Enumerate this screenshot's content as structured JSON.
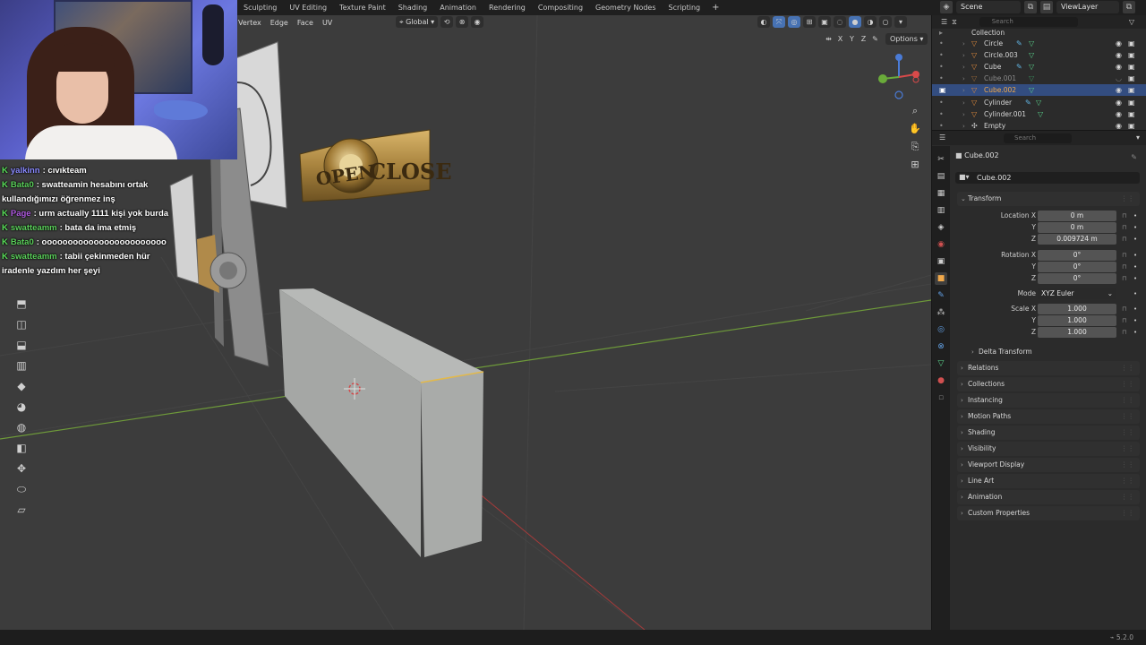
{
  "topbar": {
    "workspaces": [
      "Sculpting",
      "UV Editing",
      "Texture Paint",
      "Shading",
      "Animation",
      "Rendering",
      "Compositing",
      "Geometry Nodes",
      "Scripting"
    ],
    "add_tab": "+",
    "scene": "Scene",
    "view_layer": "ViewLayer"
  },
  "viewport_header": {
    "menus": [
      "Vertex",
      "Edge",
      "Face",
      "UV"
    ],
    "orientation": "Global",
    "options": "Options",
    "axis_x": "X",
    "axis_y": "Y",
    "axis_z": "Z"
  },
  "scene_objects": {
    "sign_left": "OPEN",
    "sign_right": "CLOSE"
  },
  "chat": [
    {
      "user": "yalkinn",
      "text": ": cıvıkteam",
      "color": "#7a7aff"
    },
    {
      "user": "Bata0",
      "text": ": swatteamin hesabını ortak kullandığımızı öğrenmez inş",
      "color": "#5ad05a"
    },
    {
      "user": "Page",
      "text": ": urm actually 1111 kişi yok burda",
      "color": "#b05ae0"
    },
    {
      "user": "swatteamm",
      "text": ": bata da ima etmiş",
      "color": "#5ad05a"
    },
    {
      "user": "Bata0",
      "text": ": oooooooooooooooooooooooo",
      "color": "#5ad05a"
    },
    {
      "user": "swatteamm",
      "text": ": tabii çekinmeden hür iradenle yazdım her şeyi",
      "color": "#5ad05a"
    }
  ],
  "chat_badge": "K",
  "outliner": {
    "search_placeholder": "Search",
    "collection": "Collection",
    "items": [
      {
        "name": "Circle",
        "selected": false,
        "dim": false
      },
      {
        "name": "Circle.003",
        "selected": false,
        "dim": false
      },
      {
        "name": "Cube",
        "selected": false,
        "dim": false
      },
      {
        "name": "Cube.001",
        "selected": false,
        "dim": true
      },
      {
        "name": "Cube.002",
        "selected": true,
        "dim": false
      },
      {
        "name": "Cylinder",
        "selected": false,
        "dim": false
      },
      {
        "name": "Cylinder.001",
        "selected": false,
        "dim": false
      },
      {
        "name": "Empty",
        "selected": false,
        "dim": false
      }
    ]
  },
  "properties": {
    "search_placeholder": "Search",
    "object_name": "Cube.002",
    "object_field": "Cube.002",
    "transform_title": "Transform",
    "location_label": "Location X",
    "location": {
      "x": "0 m",
      "y": "0 m",
      "z": "0.009724 m"
    },
    "rotation_label": "Rotation X",
    "rotation": {
      "x": "0°",
      "y": "0°",
      "z": "0°"
    },
    "mode_label": "Mode",
    "mode_value": "XYZ Euler",
    "scale_label": "Scale X",
    "scale": {
      "x": "1.000",
      "y": "1.000",
      "z": "1.000"
    },
    "axis_y": "Y",
    "axis_z": "Z",
    "delta_transform": "Delta Transform",
    "panels": [
      "Relations",
      "Collections",
      "Instancing",
      "Motion Paths",
      "Shading",
      "Visibility",
      "Viewport Display",
      "Line Art",
      "Animation",
      "Custom Properties"
    ]
  },
  "status": {
    "version": "5.2.0"
  }
}
